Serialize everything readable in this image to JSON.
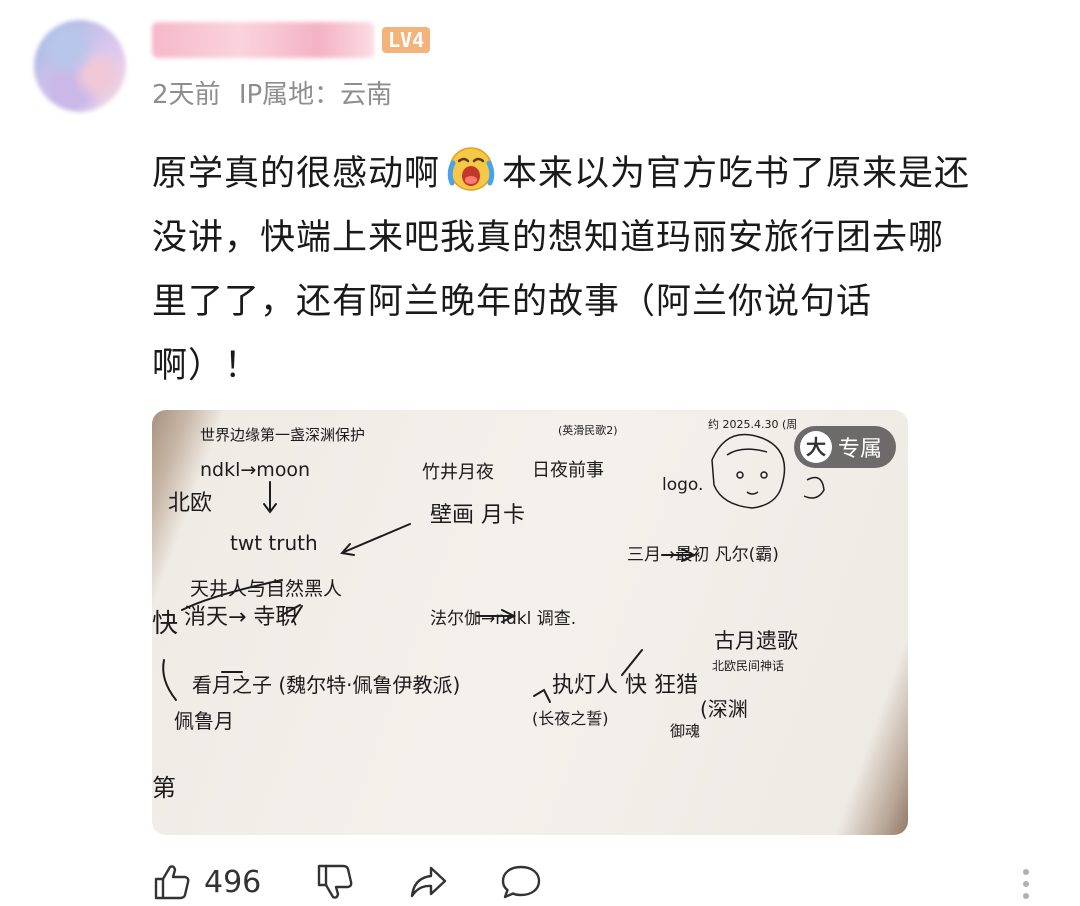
{
  "header": {
    "level_badge": "LV4",
    "time_ago": "2天前",
    "ip_location": "IP属地：云南"
  },
  "comment": {
    "lines": [
      {
        "a": "原学真的很感动啊",
        "emoji": "crying-face-emoji",
        "b": "本来以为官方吃书了原来是还"
      },
      {
        "a": "没讲，快端上来吧我真的想知道玛丽安旅行团去哪"
      },
      {
        "a": "里了了，还有阿兰晚年的故事（阿兰你说句话"
      },
      {
        "a": "啊）！"
      }
    ]
  },
  "photo": {
    "badge_icon_label": "大",
    "badge_label": "专属",
    "handwriting": {
      "t1": "世界边缘第一盏深渊保护",
      "t2": "(英滑民歌2)",
      "t3": "约 2025.4.30 (周",
      "t4": "ndkl→moon",
      "t5": "竹井月夜",
      "t6": "日夜前事",
      "t7": "北欧",
      "t8": "logo.",
      "t9": "壁画  月卡",
      "t10": "twt truth",
      "t11": "三月→最初  凡尔(霸)",
      "t12": "天井人与自然黑人",
      "t13": "快",
      "t14": "消天→  寺职",
      "t15": "法尔伽→ndkl 调查.",
      "t16": "古月遗歌",
      "t17": "北欧民间神话",
      "t18": "看月之子  (魏尔特·佩鲁伊教派)",
      "t19": "执灯人 快 狂猎",
      "t20": "佩鲁月",
      "t21": "(长夜之誓)",
      "t22": "御魂",
      "t23": "(深渊",
      "t24": "第"
    }
  },
  "actions": {
    "like_count": "496"
  },
  "colors": {
    "meta_gray": "#8e8e8e",
    "level_orange": "#f3b37b",
    "text": "#1a1a1a"
  }
}
